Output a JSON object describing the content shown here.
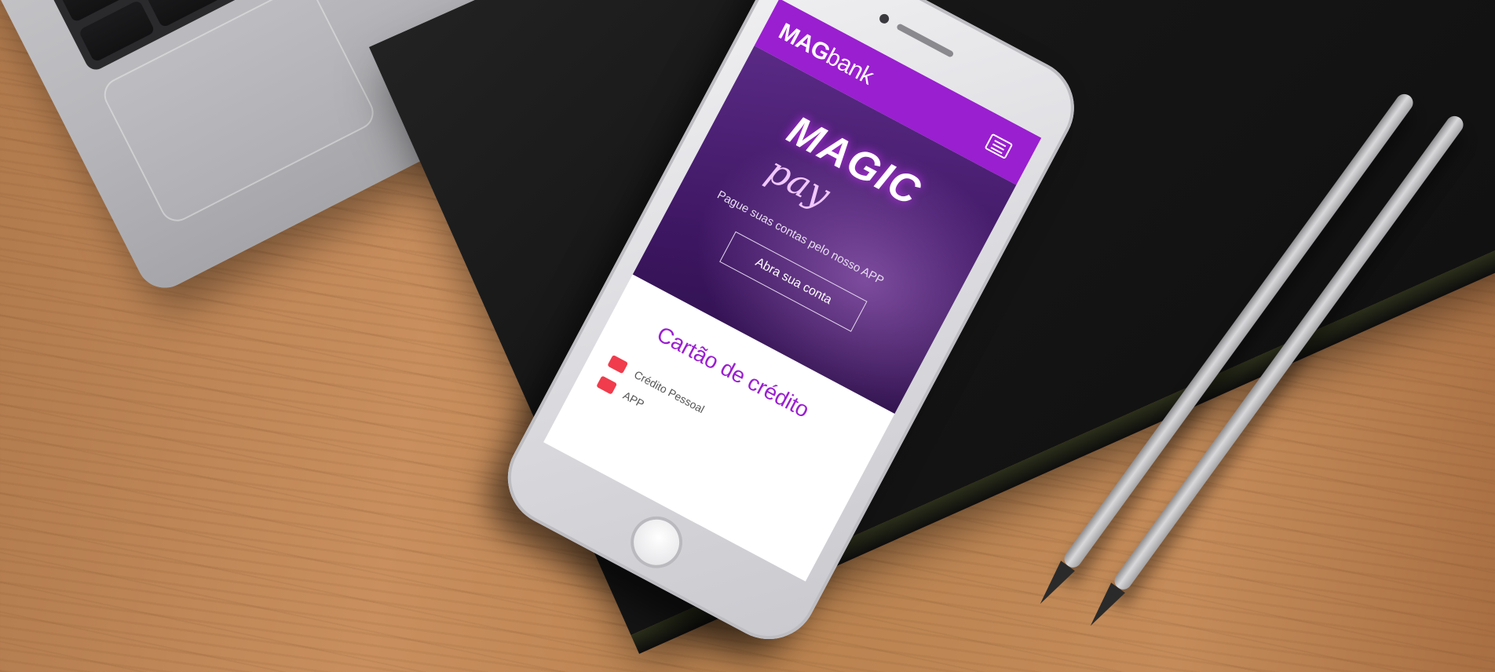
{
  "app": {
    "brand_bold": "MAG",
    "brand_light": "bank"
  },
  "hero": {
    "title": "MAGIC",
    "subtitle": "pay",
    "text": "Pague suas contas pelo nosso APP",
    "button_label": "Abra sua conta"
  },
  "section": {
    "title": "Cartão de crédito"
  },
  "list": {
    "items": [
      {
        "label": "Crédito Pessoal",
        "icon": "card-icon"
      },
      {
        "label": "APP",
        "icon": "phone-icon"
      }
    ]
  },
  "colors": {
    "brand": "#9a1fd0",
    "accent": "#f03c4c"
  }
}
